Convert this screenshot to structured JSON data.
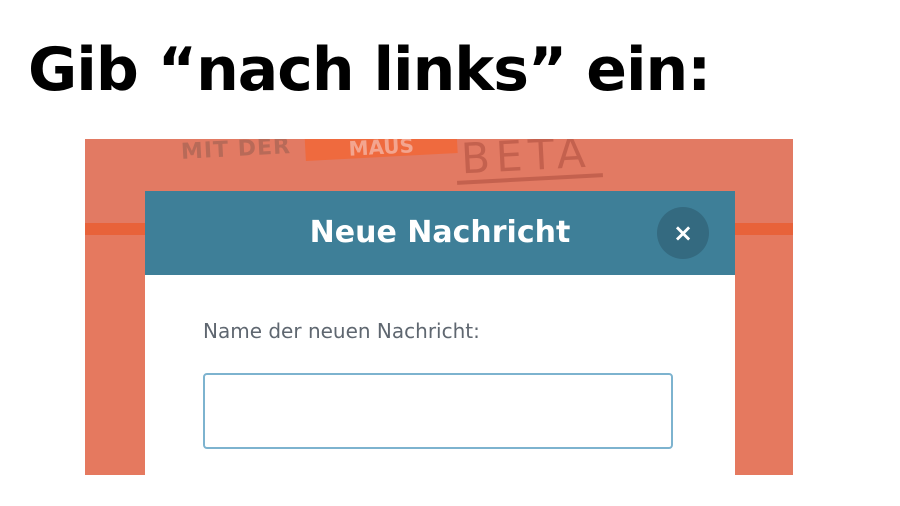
{
  "instruction": "Gib “nach links” ein:",
  "background_logo": {
    "dark_text": "MIT DER",
    "box_text": "MAUS",
    "beta_text": "BETA"
  },
  "modal": {
    "title": "Neue Nachricht",
    "close_icon": "close-icon",
    "close_glyph": "×",
    "field_label": "Name der neuen Nachricht:",
    "name_input": {
      "value": "",
      "placeholder": ""
    }
  },
  "colors": {
    "page_background": "#e5795f",
    "header_stripe": "#e8623a",
    "modal_header": "#3e7f98",
    "close_button": "#346a80",
    "input_border": "#7db3cf"
  }
}
